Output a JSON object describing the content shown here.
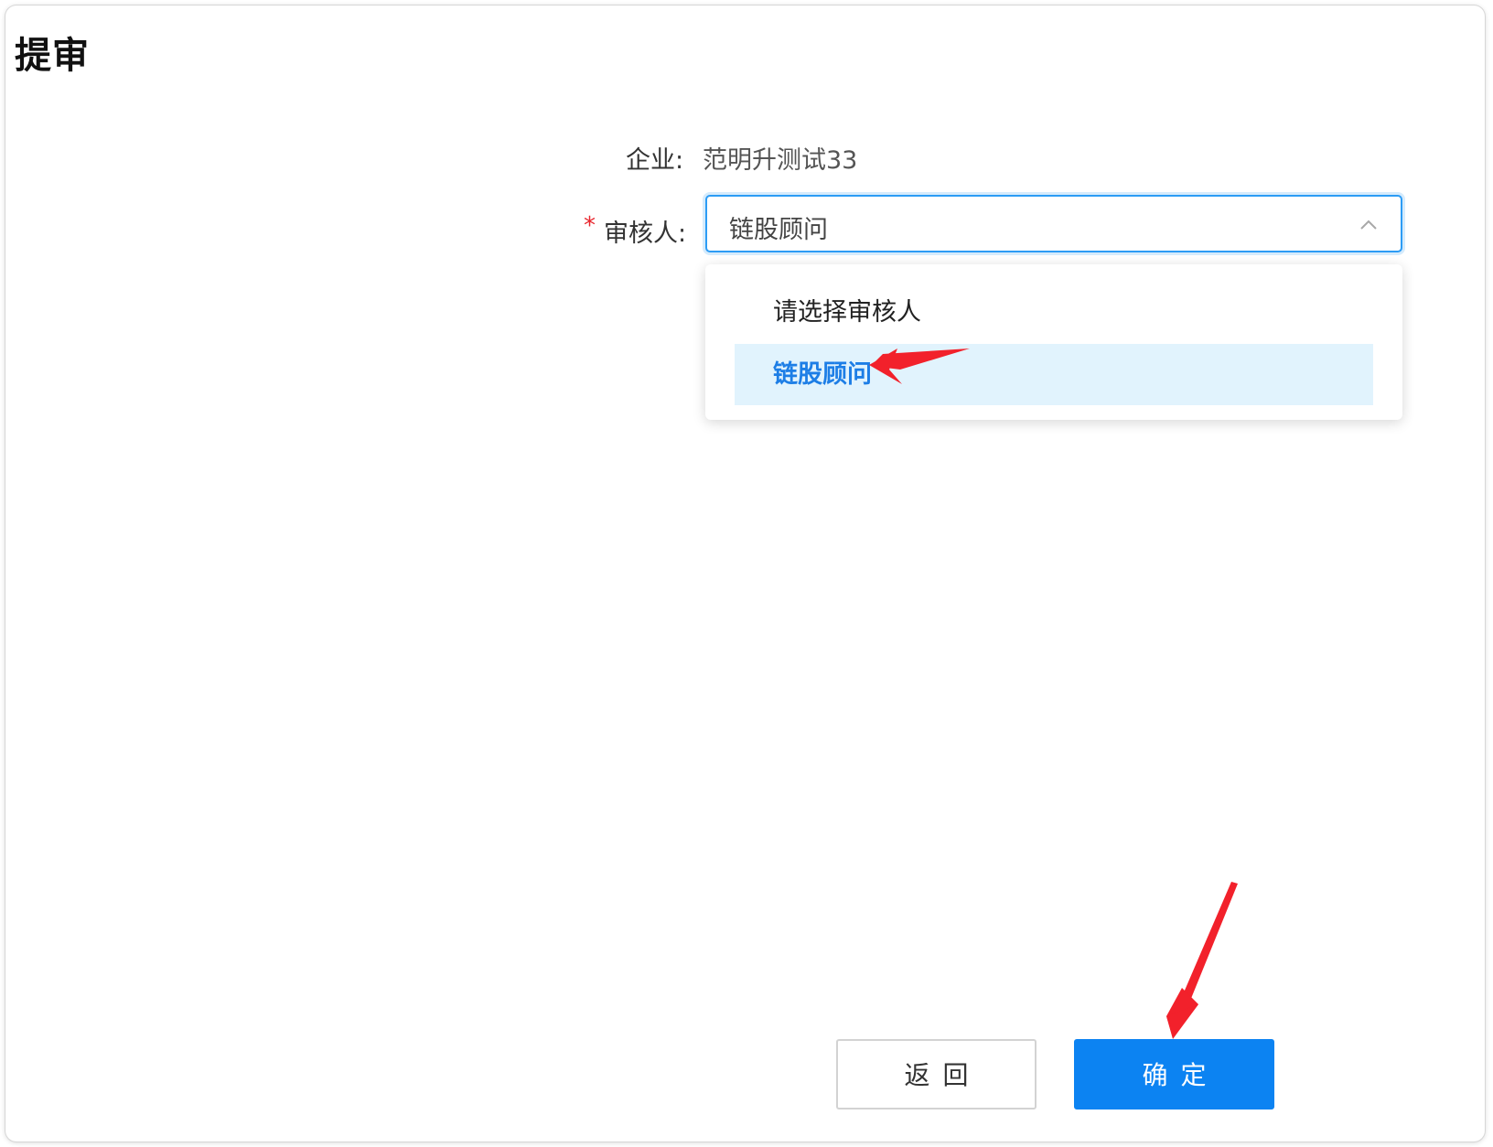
{
  "page": {
    "title": "提审"
  },
  "form": {
    "company_label": "企业:",
    "company_value": "范明升测试33",
    "reviewer_required_mark": "*",
    "reviewer_label": "审核人:",
    "reviewer_selected": "链股顾问"
  },
  "dropdown": {
    "options": [
      {
        "label": "请选择审核人",
        "selected": false
      },
      {
        "label": "链股顾问",
        "selected": true
      }
    ]
  },
  "buttons": {
    "back_label": "返回",
    "confirm_label": "确定"
  },
  "colors": {
    "primary": "#0c83f2",
    "select_border": "#2c9cf5",
    "selected_option_bg": "#e1f3fd",
    "selected_option_text": "#1d7ee6",
    "required_star": "#e8262d",
    "annotation_arrow": "#f2212b"
  },
  "icons": {
    "select_toggle": "chevron-up-icon",
    "annotations": [
      "red-arrow-icon",
      "red-arrow-icon"
    ]
  }
}
